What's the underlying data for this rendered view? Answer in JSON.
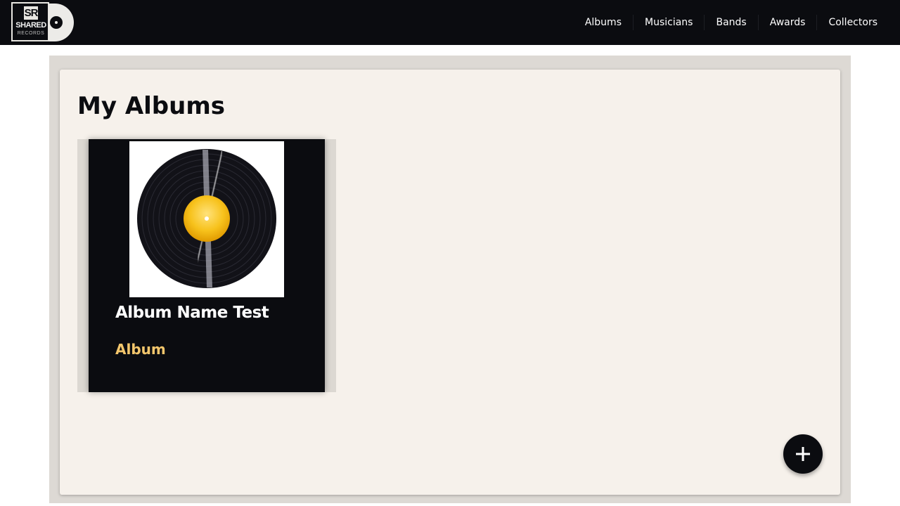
{
  "brand": {
    "logo_lines": [
      "SR",
      "SHARED",
      "RECORDS"
    ],
    "logo_icon": "vinyl-record-logo"
  },
  "nav": {
    "items": [
      {
        "label": "Albums"
      },
      {
        "label": "Musicians"
      },
      {
        "label": "Bands"
      },
      {
        "label": "Awards"
      },
      {
        "label": "Collectors"
      }
    ]
  },
  "main": {
    "title": "My Albums",
    "albums": [
      {
        "name": "Album Name Test",
        "type": "Album",
        "cover_icon": "vinyl-record-image"
      }
    ],
    "add_button_icon": "plus-icon"
  },
  "colors": {
    "navbar": "#0b0c10",
    "panel": "#f6f1eb",
    "frame": "#ddd9d4",
    "accent": "#f3c66c",
    "card": "#0b0c10"
  }
}
